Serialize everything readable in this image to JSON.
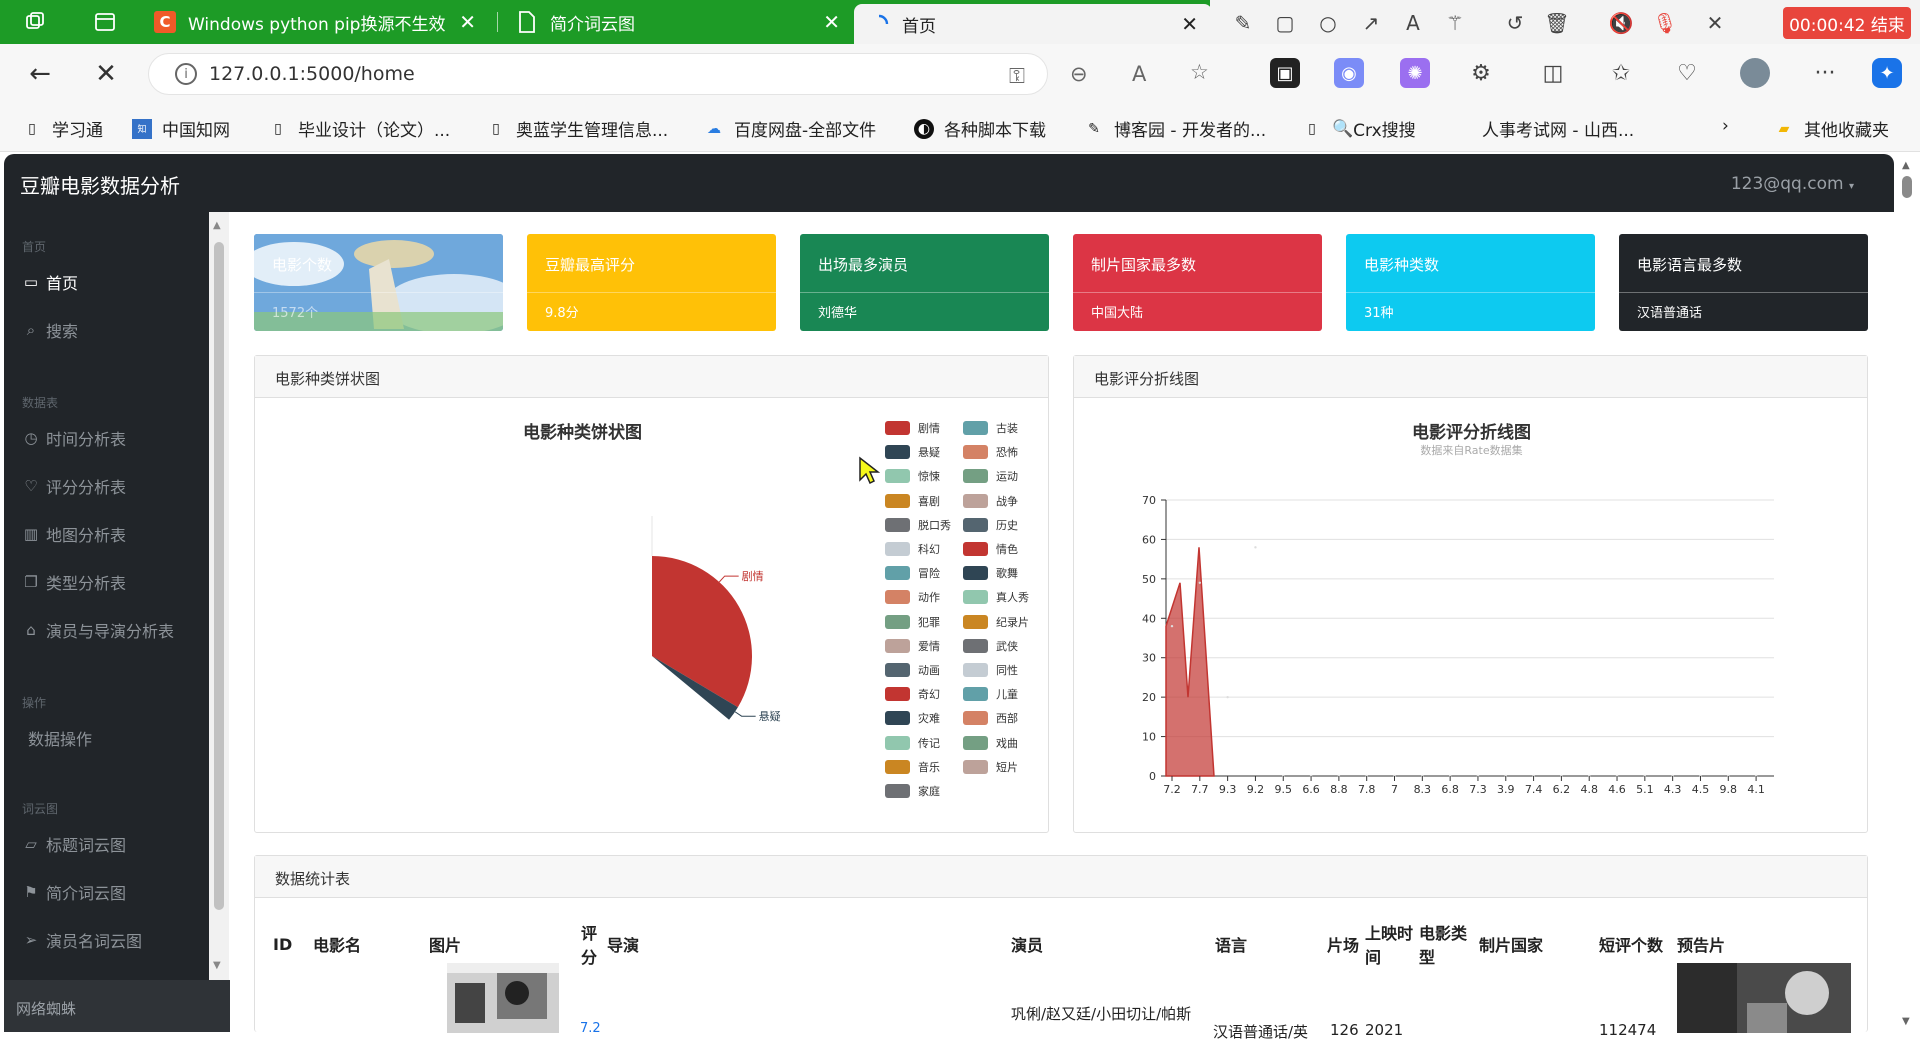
{
  "browser": {
    "tabs": [
      {
        "label": "",
        "icon": "tab-actions-icon"
      },
      {
        "label": "",
        "icon": "tab-list-icon"
      },
      {
        "label": "Windows python pip换源不生效",
        "icon": "csdn-logo-icon"
      },
      {
        "label": "简介词云图",
        "icon": "page-icon"
      },
      {
        "label": "首页",
        "icon": "loading-icon",
        "active": true
      }
    ],
    "timer": "00:00:42 结束",
    "url": "127.0.0.1:5000/home",
    "bookmarks": [
      "学习通",
      "中国知网",
      "毕业设计（论文）...",
      "奥蓝学生管理信息...",
      "百度网盘-全部文件",
      "各种脚本下载",
      "博客园 - 开发者的...",
      "Crx搜搜",
      "人事考试网 - 山西...",
      "其他收藏夹"
    ]
  },
  "app": {
    "brand": "豆瓣电影数据分析",
    "user": "123@qq.com"
  },
  "sidebar": {
    "sections": [
      {
        "heading": "首页",
        "items": [
          {
            "label": "首页",
            "icon": "monitor-icon",
            "active": true
          },
          {
            "label": "搜索",
            "icon": "search-icon"
          }
        ]
      },
      {
        "heading": "数据表",
        "items": [
          {
            "label": "时间分析表",
            "icon": "clock-icon"
          },
          {
            "label": "评分分析表",
            "icon": "heart-icon"
          },
          {
            "label": "地图分析表",
            "icon": "map-icon"
          },
          {
            "label": "类型分析表",
            "icon": "copy-icon"
          },
          {
            "label": "演员与导演分析表",
            "icon": "bank-icon"
          }
        ]
      },
      {
        "heading": "操作",
        "items": [
          {
            "label": "数据操作",
            "icon": ""
          }
        ]
      },
      {
        "heading": "词云图",
        "items": [
          {
            "label": "标题词云图",
            "icon": "comment-icon"
          },
          {
            "label": "简介词云图",
            "icon": "flag-icon"
          },
          {
            "label": "演员名词云图",
            "icon": "send-icon"
          }
        ]
      }
    ],
    "footer": "网络蜘蛛"
  },
  "cards": [
    {
      "title": "电影个数",
      "value": "1572个",
      "color": "#5a9bd4"
    },
    {
      "title": "豆瓣最高评分",
      "value": "9.8分",
      "color": "#ffc107"
    },
    {
      "title": "出场最多演员",
      "value": "刘德华",
      "color": "#198754"
    },
    {
      "title": "制片国家最多数",
      "value": "中国大陆",
      "color": "#dc3545"
    },
    {
      "title": "电影种类数",
      "value": "31种",
      "color": "#0dcaf0"
    },
    {
      "title": "电影语言最多数",
      "value": "汉语普通话",
      "color": "#212529"
    }
  ],
  "pie_panel": {
    "header": "电影种类饼状图"
  },
  "line_panel": {
    "header": "电影评分折线图"
  },
  "table_panel": {
    "header": "数据统计表",
    "columns": [
      "ID",
      "电影名",
      "图片",
      "评分",
      "导演",
      "演员",
      "语言",
      "片场",
      "上映时间",
      "电影类型",
      "制片国家",
      "短评个数",
      "预告片"
    ],
    "partial_row": {
      "score": "7.2",
      "actors": "巩俐/赵又廷/小田切让/帕斯",
      "language": "汉语普通话/英",
      "runtime": "126",
      "year": "2021",
      "comments": "112474"
    }
  },
  "chart_data": [
    {
      "type": "pie",
      "title": "电影种类饼状图",
      "categories": [
        "剧情",
        "喜剧",
        "动作",
        "爱情",
        "科幻",
        "动画",
        "悬疑",
        "惊悚",
        "恐怖",
        "犯罪",
        "同性",
        "音乐",
        "歌舞",
        "传记",
        "历史",
        "战争",
        "西部",
        "奇幻",
        "冒险",
        "灾难",
        "武侠",
        "古装",
        "运动",
        "短片",
        "纪录片",
        "家庭",
        "儿童",
        "真人秀",
        "脱口秀",
        "戏曲",
        "情色"
      ],
      "legend": [
        "剧情",
        "古装",
        "悬疑",
        "恐怖",
        "惊悚",
        "运动",
        "喜剧",
        "战争",
        "脱口秀",
        "历史",
        "科幻",
        "情色",
        "冒险",
        "歌舞",
        "动作",
        "真人秀",
        "犯罪",
        "纪录片",
        "爱情",
        "武侠",
        "动画",
        "同性",
        "奇幻",
        "儿童",
        "灾难",
        "西部",
        "传记",
        "戏曲",
        "音乐",
        "短片",
        "家庭"
      ],
      "legend_colors": [
        "#c23531",
        "#61a0a8",
        "#2f4554",
        "#d48265",
        "#91c7ae",
        "#749f83",
        "#ca8622",
        "#bda29a",
        "#6e7074",
        "#546570",
        "#c4ccd3"
      ],
      "slices": [
        {
          "name": "剧情",
          "value": 1100
        },
        {
          "name": "悬疑",
          "value": 80
        }
      ],
      "labels": [
        "剧情",
        "悬疑"
      ]
    },
    {
      "type": "area",
      "title": "电影评分折线图",
      "subtitle": "数据来自Rate数据集",
      "ylim": [
        0,
        70
      ],
      "yticks": [
        0,
        10,
        20,
        30,
        40,
        50,
        60,
        70
      ],
      "categories": [
        "7.2",
        "7.7",
        "9.3",
        "9.2",
        "9.5",
        "6.6",
        "8.8",
        "7.8",
        "7",
        "8.3",
        "6.8",
        "7.3",
        "3.9",
        "7.4",
        "6.2",
        "4.8",
        "4.6",
        "5.1",
        "4.3",
        "4.5",
        "9.8",
        "4.1"
      ],
      "values": [
        38,
        49,
        20,
        58,
        0,
        0,
        0,
        0,
        0,
        0,
        0,
        0,
        0,
        0,
        0,
        0,
        0,
        0,
        0,
        0,
        0,
        0
      ],
      "color": "#c23531"
    }
  ]
}
